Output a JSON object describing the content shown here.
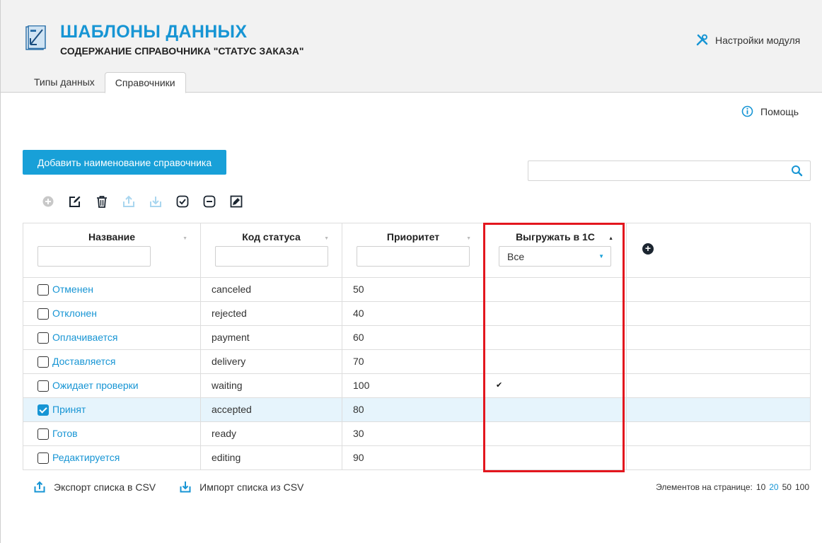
{
  "header": {
    "title": "ШАБЛОНЫ ДАННЫХ",
    "subtitle": "СОДЕРЖАНИЕ СПРАВОЧНИКА \"СТАТУС ЗАКАЗА\"",
    "settings_label": "Настройки модуля"
  },
  "tabs": [
    {
      "label": "Типы данных",
      "active": false
    },
    {
      "label": "Справочники",
      "active": true
    }
  ],
  "help_label": "Помощь",
  "add_button_label": "Добавить наименование справочника",
  "search": {
    "value": "",
    "placeholder": ""
  },
  "toolbar_icons": [
    "add-circle-icon",
    "edit-icon",
    "trash-icon",
    "export-icon",
    "import-icon",
    "check-circle-icon",
    "minus-circle-icon",
    "edit-square-icon"
  ],
  "table": {
    "columns": [
      {
        "title": "Название"
      },
      {
        "title": "Код статуса"
      },
      {
        "title": "Приоритет"
      },
      {
        "title": "Выгружать в 1С",
        "filter_value": "Все"
      }
    ],
    "rows": [
      {
        "name": "Отменен",
        "code": "canceled",
        "priority": "50",
        "export": "",
        "checked": false
      },
      {
        "name": "Отклонен",
        "code": "rejected",
        "priority": "40",
        "export": "",
        "checked": false
      },
      {
        "name": "Оплачивается",
        "code": "payment",
        "priority": "60",
        "export": "",
        "checked": false
      },
      {
        "name": "Доставляется",
        "code": "delivery",
        "priority": "70",
        "export": "",
        "checked": false
      },
      {
        "name": "Ожидает проверки",
        "code": "waiting",
        "priority": "100",
        "export": "✔",
        "checked": false
      },
      {
        "name": "Принят",
        "code": "accepted",
        "priority": "80",
        "export": "",
        "checked": true
      },
      {
        "name": "Готов",
        "code": "ready",
        "priority": "30",
        "export": "",
        "checked": false
      },
      {
        "name": "Редактируется",
        "code": "editing",
        "priority": "90",
        "export": "",
        "checked": false
      }
    ]
  },
  "footer": {
    "export_label": "Экспорт списка в CSV",
    "import_label": "Импорт списка из CSV",
    "per_page_label": "Элементов на странице:",
    "per_page_options": [
      "10",
      "20",
      "50",
      "100"
    ],
    "per_page_current": "20"
  },
  "colors": {
    "accent": "#1795d4",
    "button": "#18a0d8",
    "highlight": "#e3161e",
    "selected_row": "#e6f4fc"
  }
}
